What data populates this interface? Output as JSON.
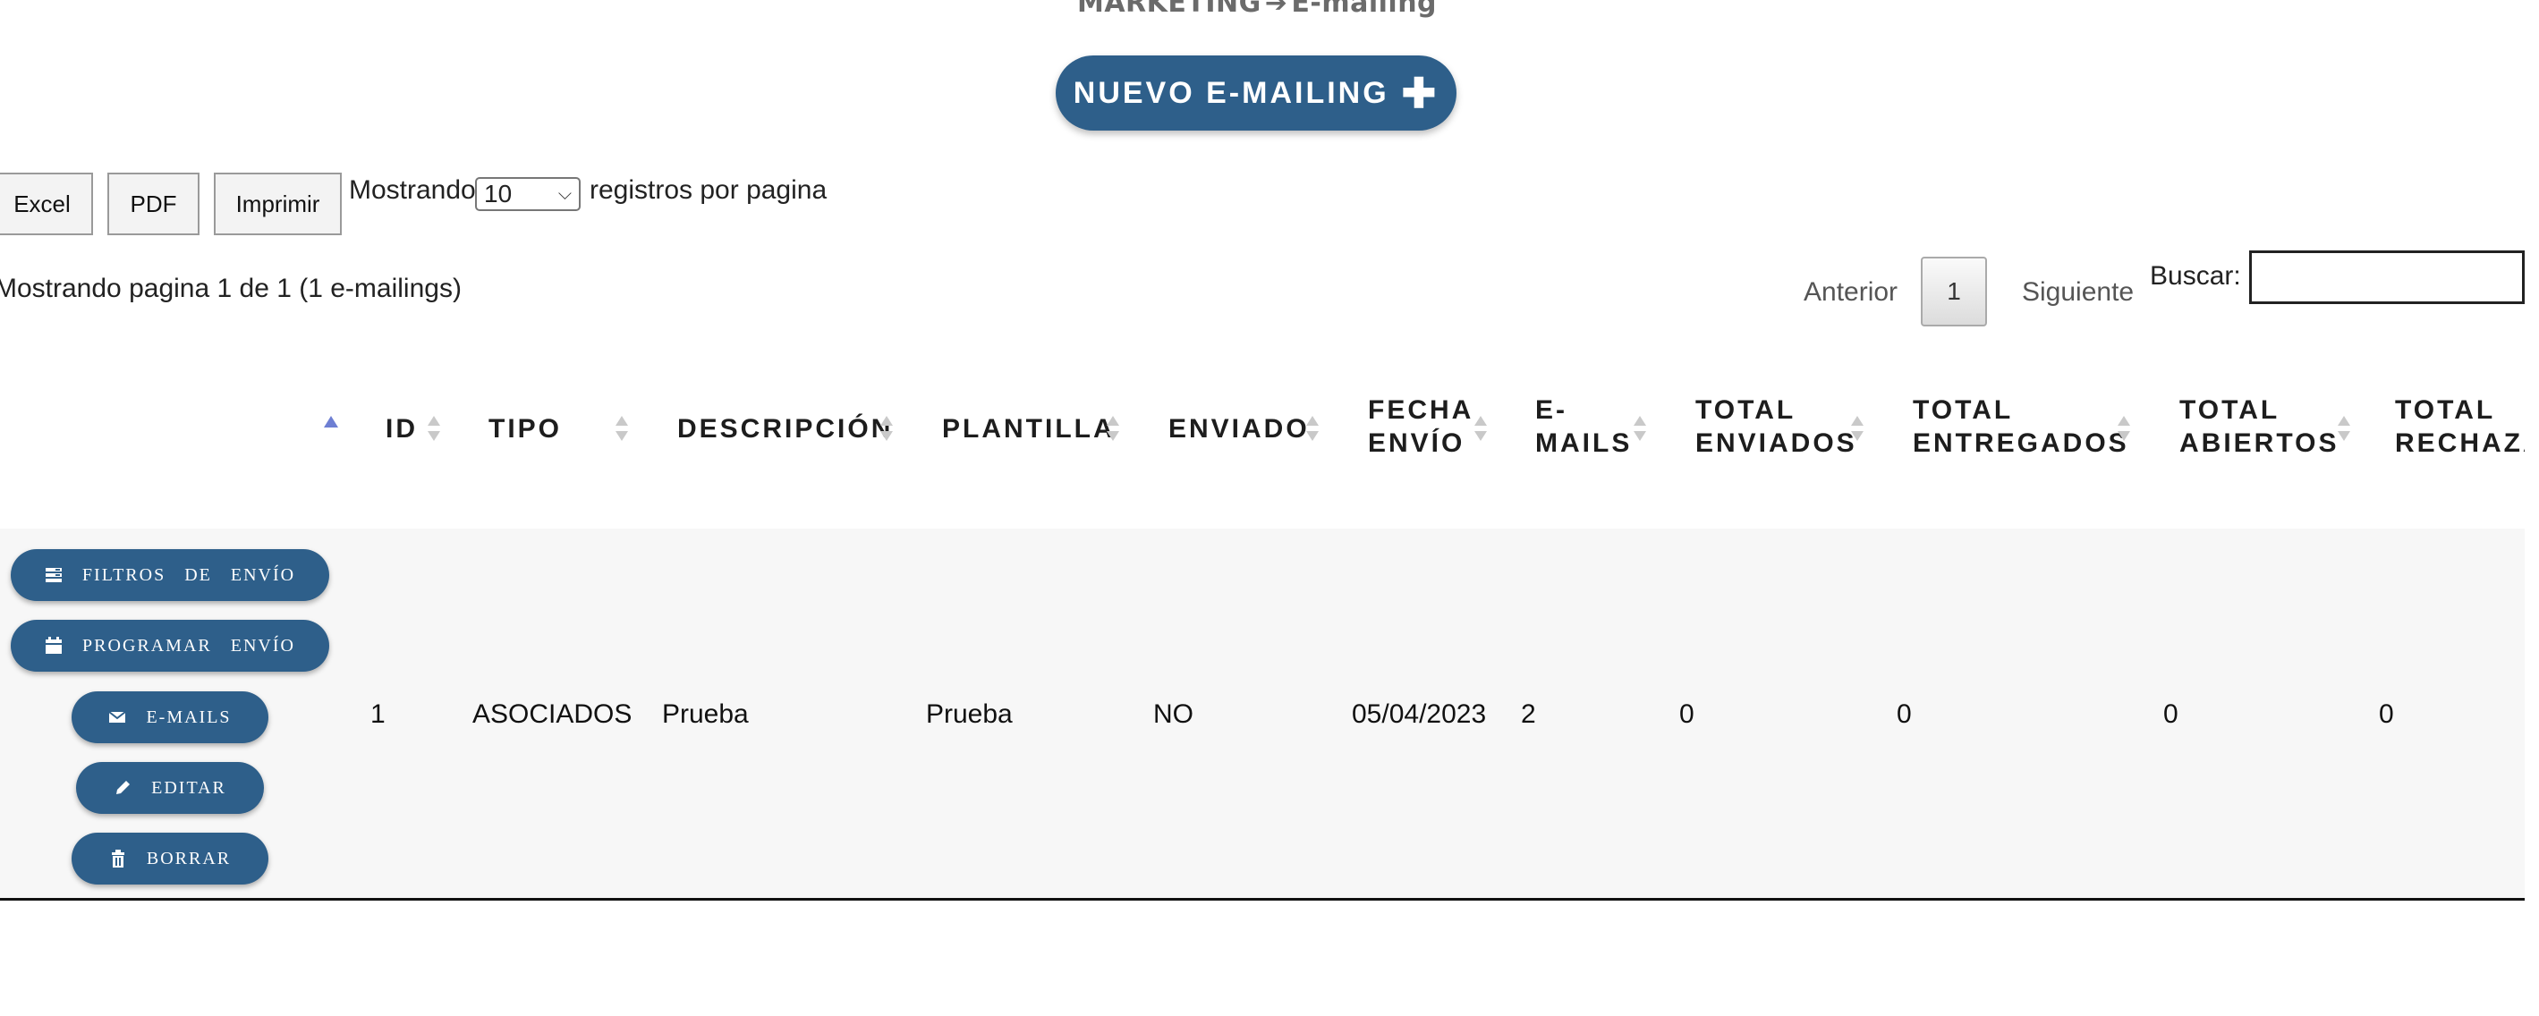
{
  "breadcrumb": {
    "section": "MARKETING",
    "separator": "➔",
    "current": "E-mailing"
  },
  "new_button": {
    "label": "NUEVO E-MAILING",
    "icon": "plus-icon"
  },
  "export_buttons": {
    "excel": "Excel",
    "pdf": "PDF",
    "print": "Imprimir"
  },
  "length_menu": {
    "prefix": "Mostrando",
    "selected": "10",
    "suffix": "registros por pagina"
  },
  "info": "Mostrando pagina 1 de 1 (1 e-mailings)",
  "pagination": {
    "previous": "Anterior",
    "current_page": "1",
    "next": "Siguiente"
  },
  "search": {
    "label": "Buscar:",
    "value": ""
  },
  "table": {
    "headers": {
      "id": "ID",
      "tipo": "TIPO",
      "descripcion": "DESCRIPCIÓN",
      "plantilla": "PLANTILLA",
      "enviado": "ENVIADO",
      "fecha_envio_1": "FECHA",
      "fecha_envio_2": "ENVÍO",
      "emails_1": "E-",
      "emails_2": "MAILS",
      "total_enviados_1": "TOTAL",
      "total_enviados_2": "ENVIADOS",
      "total_entregados_1": "TOTAL",
      "total_entregados_2": "ENTREGADOS",
      "total_abiertos_1": "TOTAL",
      "total_abiertos_2": "ABIERTOS",
      "total_rechazados_1": "TOTAL",
      "total_rechazados_2": "RECHAZA"
    },
    "row": {
      "actions": {
        "filtros": "FILTROS DE ENVÍO",
        "programar": "PROGRAMAR ENVÍO",
        "emails": "E-MAILS",
        "editar": "EDITAR",
        "borrar": "BORRAR"
      },
      "id": "1",
      "tipo": "ASOCIADOS",
      "descripcion": "Prueba",
      "plantilla": "Prueba",
      "enviado": "NO",
      "fecha_envio": "05/04/2023",
      "emails": "2",
      "total_enviados": "0",
      "total_entregados": "0",
      "total_abiertos": "0",
      "total_rechazados": "0"
    }
  },
  "colors": {
    "primary_button": "#2e5f8a",
    "sort_active": "#6e7fd3",
    "row_bg": "#f7f7f7"
  }
}
